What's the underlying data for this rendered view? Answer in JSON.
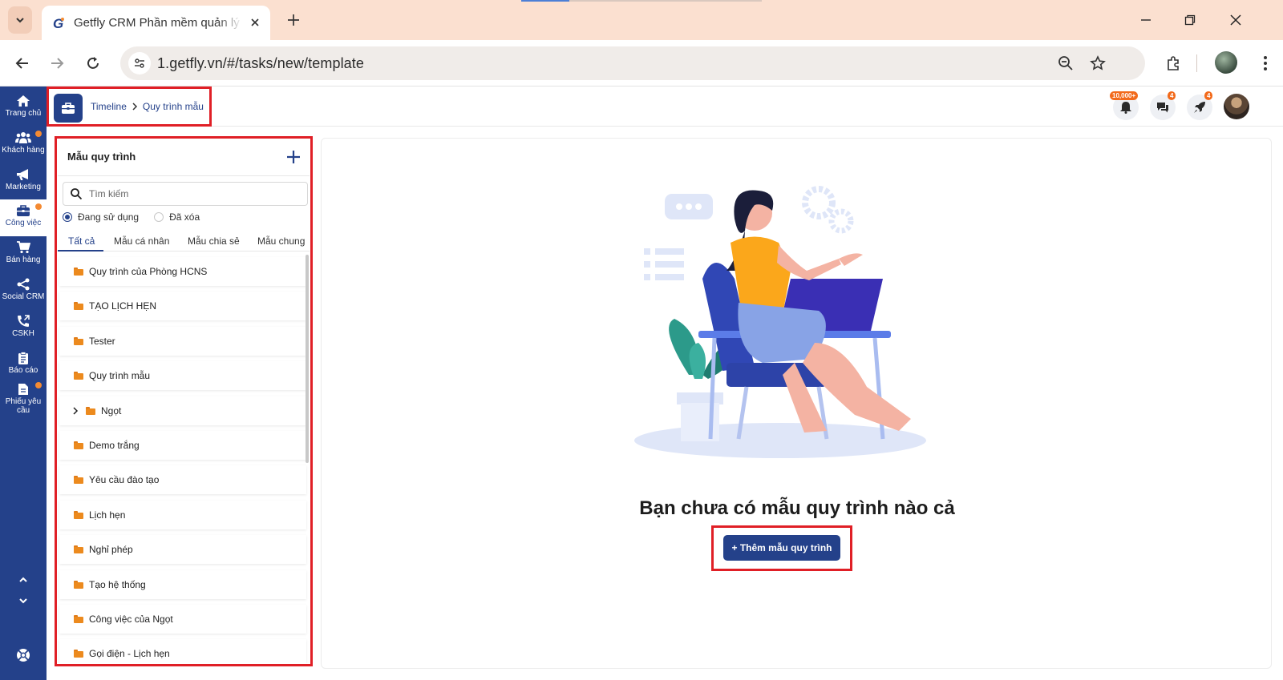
{
  "browser": {
    "tab_title": "Getfly CRM Phần mềm quản lý",
    "url": "1.getfly.vn/#/tasks/new/template"
  },
  "sidebar": {
    "items": [
      {
        "label": "Trang chủ",
        "icon": "home-icon"
      },
      {
        "label": "Khách hàng",
        "icon": "users-icon",
        "dot": true
      },
      {
        "label": "Marketing",
        "icon": "megaphone-icon"
      },
      {
        "label": "Công việc",
        "icon": "briefcase-icon",
        "dot": true,
        "active": true
      },
      {
        "label": "Bán hàng",
        "icon": "cart-icon"
      },
      {
        "label": "Social CRM",
        "icon": "share-icon"
      },
      {
        "label": "CSKH",
        "icon": "phone-icon"
      },
      {
        "label": "Báo cáo",
        "icon": "clipboard-icon"
      },
      {
        "label": "Phiếu yêu cầu",
        "icon": "document-icon",
        "dot": true
      }
    ]
  },
  "header": {
    "breadcrumb": [
      "Timeline",
      "Quy trình mẫu"
    ],
    "notification_badge": "10,000+",
    "chat_badge": "4",
    "rocket_badge": "4"
  },
  "panel": {
    "title": "Mẫu quy trình",
    "search_placeholder": "Tìm kiếm",
    "filter_active": "Đang sử dụng",
    "filter_deleted": "Đã xóa",
    "tabs": [
      "Tất cả",
      "Mẫu cá nhân",
      "Mẫu chia sẻ",
      "Mẫu chung"
    ],
    "items": [
      {
        "label": "Quy trình của Phòng HCNS"
      },
      {
        "label": "TẠO LỊCH HẸN"
      },
      {
        "label": "Tester"
      },
      {
        "label": "Quy trình mẫu"
      },
      {
        "label": "Ngọt",
        "expandable": true
      },
      {
        "label": "Demo trắng"
      },
      {
        "label": "Yêu cầu đào tạo"
      },
      {
        "label": "Lịch hẹn"
      },
      {
        "label": "Nghỉ phép"
      },
      {
        "label": "Tạo hệ thống"
      },
      {
        "label": "Công việc của Ngọt"
      },
      {
        "label": "Gọi điện - Lịch hẹn"
      }
    ]
  },
  "main": {
    "empty_message": "Bạn chưa có mẫu quy trình nào cả",
    "add_button": "+ Thêm mẫu quy trình"
  },
  "colors": {
    "brand": "#24418a",
    "accent": "#f48a32",
    "highlight": "#e01f26"
  }
}
